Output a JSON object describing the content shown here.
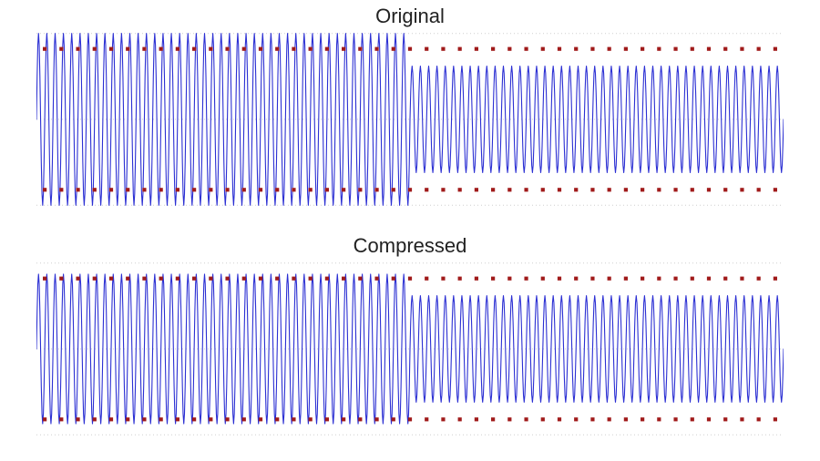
{
  "chart_data": [
    {
      "type": "line",
      "title": "Original",
      "xlabel": "",
      "ylabel": "",
      "x_range": [
        0,
        1
      ],
      "y_range": [
        -1.05,
        1.05
      ],
      "grid_y": [
        -1,
        0,
        1
      ],
      "series": [
        {
          "name": "waveform",
          "kind": "sine_segments",
          "segments": [
            {
              "x_start": 0.0,
              "x_end": 0.5,
              "cycles": 45,
              "amplitude": 1.0
            },
            {
              "x_start": 0.5,
              "x_end": 1.0,
              "cycles": 45,
              "amplitude": 0.62
            }
          ],
          "color": "#2b2fd3",
          "stroke_width": 1.1
        },
        {
          "name": "threshold_markers",
          "kind": "points_constant_y",
          "x_start": 0.0,
          "x_end": 1.0,
          "count": 45,
          "y_values": [
            0.82,
            -0.82
          ],
          "color": "#a01a1a",
          "size": 4.2
        }
      ]
    },
    {
      "type": "line",
      "title": "Compressed",
      "xlabel": "",
      "ylabel": "",
      "x_range": [
        0,
        1
      ],
      "y_range": [
        -1.05,
        1.05
      ],
      "grid_y": [
        -1,
        0,
        1
      ],
      "series": [
        {
          "name": "waveform",
          "kind": "sine_segments",
          "segments": [
            {
              "x_start": 0.0,
              "x_end": 0.5,
              "cycles": 45,
              "amplitude": 0.87
            },
            {
              "x_start": 0.5,
              "x_end": 1.0,
              "cycles": 45,
              "amplitude": 0.62
            }
          ],
          "color": "#2b2fd3",
          "stroke_width": 1.1
        },
        {
          "name": "threshold_markers",
          "kind": "points_constant_y",
          "x_start": 0.0,
          "x_end": 1.0,
          "count": 45,
          "y_values": [
            0.82,
            -0.82
          ],
          "color": "#a01a1a",
          "size": 4.2
        }
      ]
    }
  ],
  "panels": {
    "0": {
      "title": "Original"
    },
    "1": {
      "title": "Compressed"
    }
  },
  "colors": {
    "wave": "#2b2fd3",
    "marker": "#a01a1a",
    "grid": "#cfcfcf"
  }
}
